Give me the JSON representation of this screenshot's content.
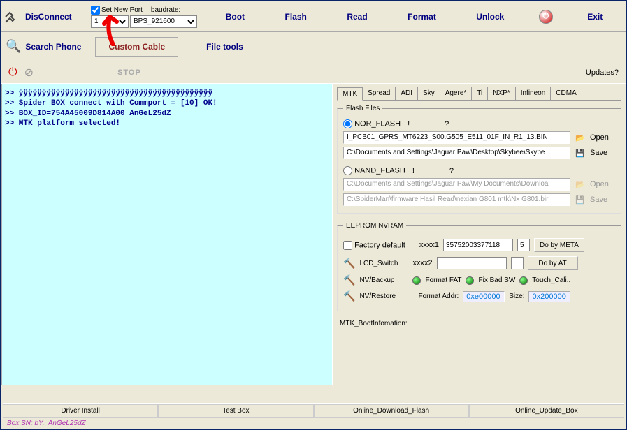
{
  "toolbar": {
    "disconnect": "DisConnect",
    "set_new_port": "Set New Port",
    "baudrate_label": "baudrate:",
    "port_value": "1",
    "baudrate_value": "BPS_921600",
    "buttons": [
      "Boot",
      "Flash",
      "Read",
      "Format",
      "Unlock",
      "Exit"
    ]
  },
  "second_row": {
    "search": "Search Phone",
    "custom_cable": "Custom Cable",
    "file_tools": "File tools"
  },
  "third_row": {
    "stop": "STOP",
    "updates": "Updates?"
  },
  "log_lines": [
    ">> ÿÿÿÿÿÿÿÿÿÿÿÿÿÿÿÿÿÿÿÿÿÿÿÿÿÿÿÿÿÿÿÿÿÿÿÿÿÿÿÿÿÿ",
    ">> Spider BOX connect with Commport = [10] OK!",
    ">> BOX_ID=754A45009D814A00 AnGeL25dZ",
    ">> MTK platform selected!"
  ],
  "tabs": [
    "MTK",
    "Spread",
    "ADI",
    "Sky",
    "Agere*",
    "Ti",
    "NXP*",
    "Infineon",
    "CDMA"
  ],
  "flash_files": {
    "legend": "Flash Files",
    "nor_label": "NOR_FLASH",
    "nor_q1": "!",
    "nor_q2": "?",
    "path1": "I_PCB01_GPRS_MT6223_S00.G505_E511_01F_IN_R1_13.BIN",
    "open": "Open",
    "path2": "C:\\Documents and Settings\\Jaguar Paw\\Desktop\\Skybee\\Skybe",
    "save": "Save",
    "nand_label": "NAND_FLASH",
    "path3": "C:\\Documents and Settings\\Jaguar Paw\\My Documents\\Downloa",
    "path4": "C:\\SpiderMan\\firmware Hasil Read\\nexian G801 mtk\\Nx G801.bir"
  },
  "eeprom": {
    "legend": "EEPROM NVRAM",
    "factory_default": "Factory default",
    "xxxx1_label": "xxxx1",
    "xxxx1_value": "35752003377118",
    "xxxx1_small": "5",
    "meta_btn": "Do by META",
    "lcd_switch": "LCD_Switch",
    "xxxx2_label": "xxxx2",
    "at_btn": "Do by AT",
    "nv_backup": "NV/Backup",
    "format_fat": "Format FAT",
    "fix_bad": "Fix Bad SW",
    "touch_cali": "Touch_Cali..",
    "nv_restore": "NV/Restore",
    "format_addr_label": "Format Addr:",
    "format_addr_value": "0xe00000",
    "size_label": "Size:",
    "size_value": "0x200000"
  },
  "bootinfo": "MTK_BootInfomation:",
  "status": {
    "cells": [
      "Driver Install",
      "Test Box",
      "Online_Download_Flash",
      "Online_Update_Box"
    ]
  },
  "box_sn": "Box SN: bY.. AnGeL25dZ"
}
